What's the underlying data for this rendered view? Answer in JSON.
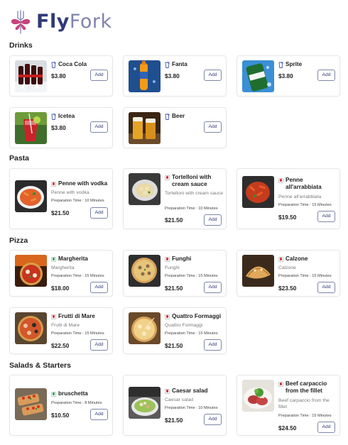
{
  "brand": {
    "name_part1": "Fly",
    "name_part2": "Fork"
  },
  "sections": [
    {
      "title": "Drinks",
      "items": [
        {
          "name": "Coca Cola",
          "price": "$3.80",
          "add_label": "Add",
          "type": "drink"
        },
        {
          "name": "Fanta",
          "price": "$3.80",
          "add_label": "Add",
          "type": "drink"
        },
        {
          "name": "Sprite",
          "price": "$3.80",
          "add_label": "Add",
          "type": "drink"
        },
        {
          "name": "Icetea",
          "price": "$3.80",
          "add_label": "Add",
          "type": "drink"
        },
        {
          "name": "Beer",
          "price": "",
          "add_label": "Add",
          "type": "drink"
        }
      ]
    },
    {
      "title": "Pasta",
      "items": [
        {
          "name": "Penne with vodka",
          "description": "Penne with vodka",
          "prep": "Preparation Time : 10 Minutes",
          "price": "$21.50",
          "add_label": "Add",
          "diet": "nonveg"
        },
        {
          "name": "Tortelloni with cream sauce",
          "description": "Tortelloni with cream sauce",
          "prep": "Preparation Time : 10 Minutes",
          "price": "$21.50",
          "add_label": "Add",
          "diet": "nonveg"
        },
        {
          "name": "Penne all'arrabbiata",
          "description": "Penne all'arrabbiata",
          "prep": "Preparation Time : 15 Minutes",
          "price": "$19.50",
          "add_label": "Add",
          "diet": "nonveg"
        }
      ]
    },
    {
      "title": "Pizza",
      "items": [
        {
          "name": "Margherita",
          "description": "Margherita",
          "prep": "Preparation Time : 15 Minutes",
          "price": "$18.00",
          "add_label": "Add",
          "diet": "veg"
        },
        {
          "name": "Funghi",
          "description": "Funghi",
          "prep": "Preparation Time : 15 Minutes",
          "price": "$21.50",
          "add_label": "Add",
          "diet": "nonveg"
        },
        {
          "name": "Calzone",
          "description": "Calzone",
          "prep": "Preparation Time : 15 Minutes",
          "price": "$23.50",
          "add_label": "Add",
          "diet": "nonveg"
        },
        {
          "name": "Frutti di Mare",
          "description": "Frutti di Mare",
          "prep": "Preparation Time : 15 Minutes",
          "price": "$22.50",
          "add_label": "Add",
          "diet": "nonveg"
        },
        {
          "name": "Quattro Formaggi",
          "description": "Quattro Formaggi",
          "prep": "Preparation Time : 15 Minutes",
          "price": "$21.50",
          "add_label": "Add",
          "diet": "nonveg"
        }
      ]
    },
    {
      "title": "Salads & Starters",
      "items": [
        {
          "name": "bruschetta",
          "description": "",
          "prep": "Preparation Time : 8 Minutes",
          "price": "$10.50",
          "add_label": "Add",
          "diet": "veg"
        },
        {
          "name": "Caesar salad",
          "description": "Caesar salad",
          "prep": "Preparation Time : 10 Minutes",
          "price": "$21.50",
          "add_label": "Add",
          "diet": "nonveg"
        },
        {
          "name": "Beef carpaccio from the fillet",
          "description": "Beef carpaccio from the fillet",
          "prep": "Preparation Time : 15 Minutes",
          "price": "$24.50",
          "add_label": "Add",
          "diet": "nonveg"
        }
      ]
    }
  ]
}
